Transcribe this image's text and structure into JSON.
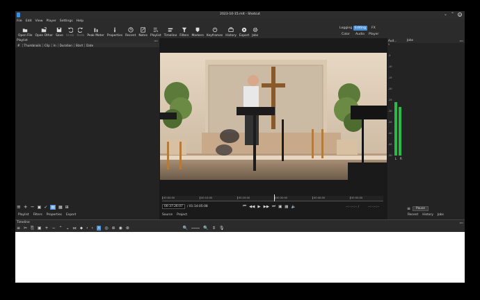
{
  "window": {
    "title": "2023-10-15.mlt - Shotcut"
  },
  "menu": [
    "File",
    "Edit",
    "View",
    "Player",
    "Settings",
    "Help"
  ],
  "toolbar": [
    {
      "label": "Open File",
      "icon": "open-file-icon",
      "enabled": true
    },
    {
      "label": "Open Other",
      "icon": "open-other-icon",
      "enabled": true
    },
    {
      "label": "Save",
      "icon": "save-icon",
      "enabled": true
    },
    {
      "label": "Undo",
      "icon": "undo-icon",
      "enabled": false
    },
    {
      "label": "Redo",
      "icon": "redo-icon",
      "enabled": false
    },
    {
      "label": "Peak Meter",
      "icon": "peak-meter-icon",
      "enabled": true
    },
    {
      "label": "Properties",
      "icon": "info-icon",
      "enabled": true
    },
    {
      "label": "Recent",
      "icon": "clock-icon",
      "enabled": true
    },
    {
      "label": "Notes",
      "icon": "notes-icon",
      "enabled": true
    },
    {
      "label": "Playlist",
      "icon": "playlist-icon",
      "enabled": true
    },
    {
      "label": "Timeline",
      "icon": "timeline-icon",
      "enabled": true
    },
    {
      "label": "Filters",
      "icon": "filter-icon",
      "enabled": true
    },
    {
      "label": "Markers",
      "icon": "marker-icon",
      "enabled": true
    },
    {
      "label": "Keyframes",
      "icon": "keyframes-icon",
      "enabled": true
    },
    {
      "label": "History",
      "icon": "history-icon",
      "enabled": true
    },
    {
      "label": "Export",
      "icon": "export-icon",
      "enabled": true
    },
    {
      "label": "Jobs",
      "icon": "gear-icon",
      "enabled": true
    }
  ],
  "layouts": {
    "row1": [
      "Logging",
      "Editing",
      "FX"
    ],
    "row2": [
      "Color",
      "Audio",
      "Player"
    ],
    "active": "Editing"
  },
  "playlist": {
    "title": "Playlist",
    "columns": [
      "#",
      "Thumbnails",
      "Clip",
      "In",
      "Duration",
      "Start",
      "Date"
    ],
    "bottom_tabs": [
      "Playlist",
      "Filters",
      "Properties",
      "Export"
    ]
  },
  "player": {
    "ruler_ticks": [
      "00:00:00",
      "00:10:00",
      "00:20:00",
      "00:30:00",
      "00:40:00",
      "00:50:00"
    ],
    "timecode": "00:37:26:07",
    "duration": "/ 01:14:05:08",
    "in_point": "--:--:--:-- /",
    "out_point": "--:--:--:--",
    "tabs": [
      "Source",
      "Project"
    ],
    "playhead_fraction": 0.505
  },
  "audio_meter": {
    "title": "Aud...",
    "scale": [
      "0",
      "-5",
      "-10",
      "-15",
      "-20",
      "-25",
      "-30",
      "-35",
      "-40",
      "-45",
      "-50"
    ],
    "channels": [
      "L",
      "R"
    ],
    "levels_db": [
      -26,
      -28
    ]
  },
  "jobs": {
    "title": "Jobs",
    "pause_label": "Pause",
    "tabs": [
      "Recent",
      "History",
      "Jobs"
    ]
  },
  "timeline": {
    "title": "Timeline"
  },
  "colors": {
    "accent": "#4a90d9",
    "meter_green": "#2fb84a",
    "panel": "#2b2b2b",
    "dark": "#1f1f1f"
  }
}
